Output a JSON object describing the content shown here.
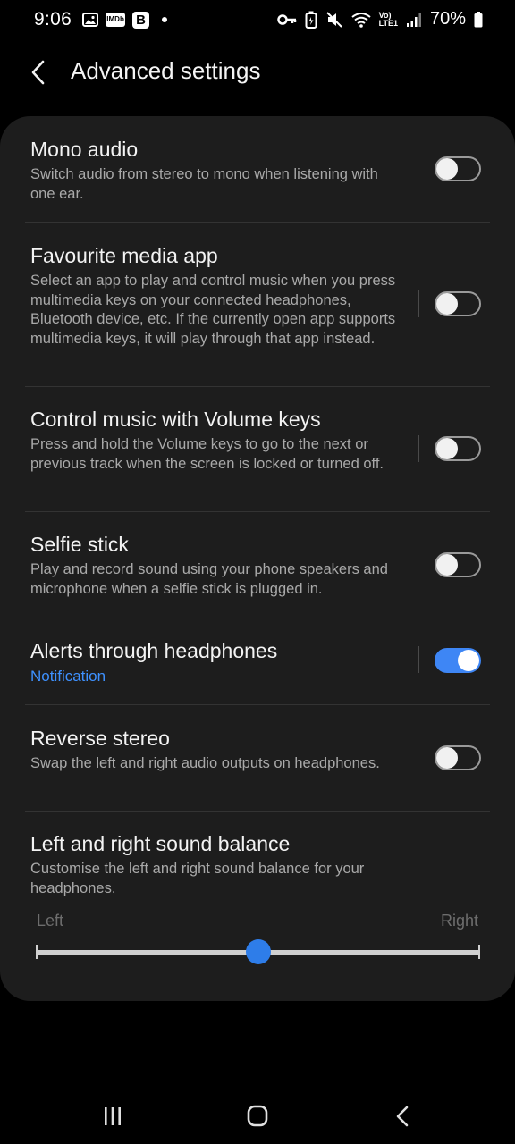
{
  "status_bar": {
    "time": "9:06",
    "left_icons": [
      "image-icon",
      "imdb-icon",
      "b-app-icon",
      "dot-icon"
    ],
    "right_icons": [
      "key-icon",
      "battery-saver-icon",
      "mute-icon",
      "wifi-icon",
      "volte-icon",
      "signal-icon",
      "battery-icon"
    ],
    "imdb_text": "IMDb",
    "b_text": "B",
    "volte_text_top": "Vo)",
    "volte_text_bottom": "LTE1",
    "battery": "70%"
  },
  "header": {
    "title": "Advanced settings"
  },
  "settings": [
    {
      "title": "Mono audio",
      "description": "Switch audio from stereo to mono when listening with one ear.",
      "enabled": false
    },
    {
      "title": "Favourite media app",
      "description": "Select an app to play and control music when you press multimedia keys on your connected headphones, Bluetooth device, etc. If the currently open app supports multimedia keys, it will play through that app instead.",
      "enabled": false
    },
    {
      "title": "Control music with Volume keys",
      "description": "Press and hold the Volume keys to go to the next or previous track when the screen is locked or turned off.",
      "enabled": false
    },
    {
      "title": "Selfie stick",
      "description": "Play and record sound using your phone speakers and microphone when a selfie stick is plugged in.",
      "enabled": false
    },
    {
      "title": "Alerts through headphones",
      "subtitle": "Notification",
      "enabled": true
    },
    {
      "title": "Reverse stereo",
      "description": "Swap the left and right audio outputs on headphones.",
      "enabled": false
    }
  ],
  "balance": {
    "title": "Left and right sound balance",
    "description": "Customise the left and right sound balance for your headphones.",
    "left_label": "Left",
    "right_label": "Right",
    "value": 0.5
  },
  "colors": {
    "accent": "#3e86f5",
    "background": "#000000",
    "card": "#1d1d1d"
  },
  "nav_bar": {
    "buttons": [
      "recents-icon",
      "home-icon",
      "back-icon"
    ]
  }
}
